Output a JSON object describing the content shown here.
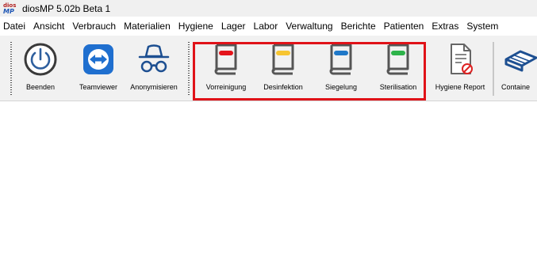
{
  "app": {
    "logo_text_top": "dios",
    "logo_text_bottom": "MP",
    "title": "diosMP  5.02b Beta 1"
  },
  "menu": [
    "Datei",
    "Ansicht",
    "Verbrauch",
    "Materialien",
    "Hygiene",
    "Lager",
    "Labor",
    "Verwaltung",
    "Berichte",
    "Patienten",
    "Extras",
    "System"
  ],
  "toolbar": {
    "beenden": "Beenden",
    "teamviewer": "Teamviewer",
    "anonymisieren": "Anonymisieren",
    "vorreinigung": "Vorreinigung",
    "desinfektion": "Desinfektion",
    "siegelung": "Siegelung",
    "sterilisation": "Sterilisation",
    "hygiene_report": "Hygiene Report",
    "container": "Containe"
  },
  "colors": {
    "vorreinigung": "#e4141b",
    "desinfektion": "#f7c531",
    "siegelung": "#1f78c8",
    "sterilisation": "#2db34a",
    "highlight": "#e01218",
    "teamviewer": "#1f6fcf"
  },
  "icons": {
    "beenden": "power-icon",
    "teamviewer": "teamviewer-icon",
    "anonymisieren": "spy-icon",
    "book": "book-icon",
    "hygiene_report": "report-icon",
    "container": "container-icon"
  }
}
